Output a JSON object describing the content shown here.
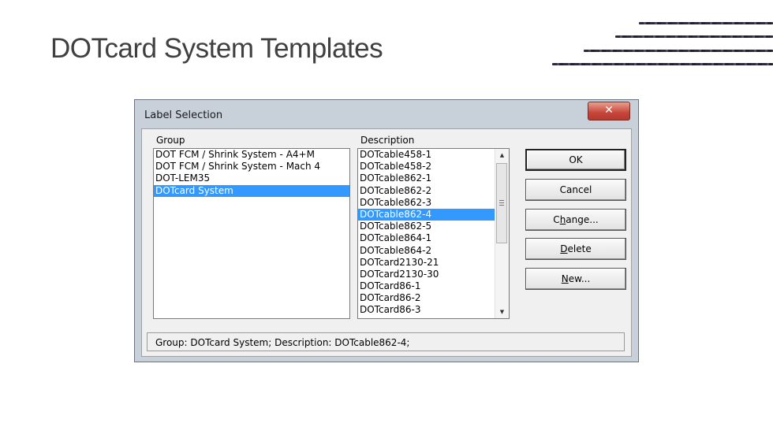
{
  "slide": {
    "title": "DOTcard System Templates"
  },
  "dialog": {
    "title": "Label Selection",
    "close_glyph": "✕",
    "group_label": "Group",
    "description_label": "Description",
    "groups": [
      {
        "label": "DOT FCM / Shrink System - A4+M",
        "selected": false
      },
      {
        "label": "DOT FCM / Shrink System - Mach 4",
        "selected": false
      },
      {
        "label": "DOT-LEM35",
        "selected": false
      },
      {
        "label": "DOTcard System",
        "selected": true
      }
    ],
    "descriptions": [
      {
        "label": "DOTcable458-1",
        "selected": false
      },
      {
        "label": "DOTcable458-2",
        "selected": false
      },
      {
        "label": "DOTcable862-1",
        "selected": false
      },
      {
        "label": "DOTcable862-2",
        "selected": false
      },
      {
        "label": "DOTcable862-3",
        "selected": false
      },
      {
        "label": "DOTcable862-4",
        "selected": true
      },
      {
        "label": "DOTcable862-5",
        "selected": false
      },
      {
        "label": "DOTcable864-1",
        "selected": false
      },
      {
        "label": "DOTcable864-2",
        "selected": false
      },
      {
        "label": "DOTcard2130-21",
        "selected": false
      },
      {
        "label": "DOTcard2130-30",
        "selected": false
      },
      {
        "label": "DOTcard86-1",
        "selected": false
      },
      {
        "label": "DOTcard86-2",
        "selected": false
      },
      {
        "label": "DOTcard86-3",
        "selected": false
      }
    ],
    "buttons": {
      "ok": "OK",
      "cancel": "Cancel",
      "change_pre": "C",
      "change_key": "h",
      "change_post": "ange...",
      "delete_key": "D",
      "delete_post": "elete",
      "new_key": "N",
      "new_post": "ew..."
    },
    "status": "Group: DOTcard System; Description: DOTcable862-4;"
  }
}
